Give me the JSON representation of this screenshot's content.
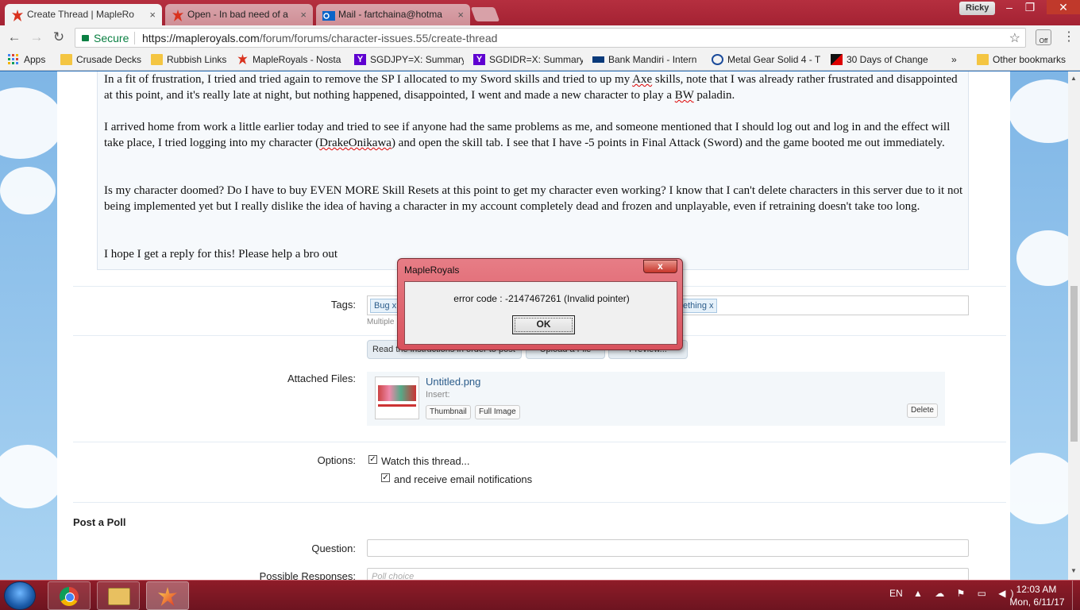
{
  "browser": {
    "tabs": [
      {
        "title": "Create Thread | MapleRo",
        "close": "×"
      },
      {
        "title": "Open - In bad need of a",
        "close": "×"
      },
      {
        "title": "Mail - fartchaina@hotma",
        "close": "×"
      }
    ],
    "profile": "Ricky",
    "secure_label": "Secure",
    "url_host": "https://mapleroyals.com",
    "url_path": "/forum/forums/character-issues.55/create-thread",
    "extension_badge": "Off",
    "bookmarks": [
      {
        "label": "Apps"
      },
      {
        "label": "Crusade Decks"
      },
      {
        "label": "Rubbish Links"
      },
      {
        "label": "MapleRoyals - Nosta"
      },
      {
        "label": "SGDJPY=X: Summary"
      },
      {
        "label": "SGDIDR=X: Summary"
      },
      {
        "label": "Bank Mandiri - Intern"
      },
      {
        "label": "Metal Gear Solid 4 - T"
      },
      {
        "label": "30 Days of Change"
      }
    ],
    "more_bookmarks": "»",
    "other_bookmarks": "Other bookmarks"
  },
  "post": {
    "p1_a": "In a fit of frustration, I tried and tried again to remove the SP I allocated to my Sword skills and tried to up my ",
    "p1_b": "Axe",
    "p1_c": " skills, note that I was already rather frustrated and disappointed at this point, and it's really late at night, but nothing happened, disappointed, I went and made a new character to play a ",
    "p1_d": "BW",
    "p1_e": " paladin.",
    "p2_a": "I arrived home from work a little earlier today and tried to see if anyone had the same problems as me, and someone mentioned that I should log out and log in and the effect will take place, I tried logging into my character (",
    "p2_b": "DrakeOnikawa",
    "p2_c": ") and open the skill tab. I see that I have -5 points in Final Attack (Sword) and the game booted me out immediately.",
    "p3": "Is my character doomed? Do I have to buy EVEN MORE Skill Resets at this point to get my character even working? I know that I can't delete characters in this server due to it not being implemented yet but I really dislike the idea of having a character in my account completely dead and frozen and unplayable, even if retraining doesn't take too long.",
    "p4": "I hope I get a reply for this! Please help a bro out"
  },
  "form": {
    "tags_label": "Tags:",
    "tags": [
      "Bug",
      "ething"
    ],
    "tag_remove": "x",
    "tags_help": "Multiple",
    "buttons": [
      "Read the instructions in order to post",
      "Upload a File",
      "Preview..."
    ],
    "attached_label": "Attached Files:",
    "file_name": "Untitled.png",
    "insert_label": "Insert:",
    "thumbnail_btn": "Thumbnail",
    "full_image_btn": "Full Image",
    "delete_btn": "Delete",
    "options_label": "Options:",
    "watch_label": "Watch this thread...",
    "email_label": "and receive email notifications",
    "watch_checked": true,
    "email_checked": true,
    "poll_heading": "Post a Poll",
    "question_label": "Question:",
    "responses_label": "Possible Responses:",
    "poll_choice_placeholder": "Poll choice"
  },
  "dialog": {
    "title": "MapleRoyals",
    "close": "x",
    "message": "error code : -2147467261 (Invalid pointer)",
    "ok": "OK"
  },
  "taskbar": {
    "language": "EN",
    "time": "12:03 AM",
    "date": "Mon, 6/11/17"
  },
  "colors": {
    "titlebar": "#b52f3f",
    "taskbar": "#8e1c28",
    "secure": "#0b8043",
    "link": "#2b5c8a"
  }
}
